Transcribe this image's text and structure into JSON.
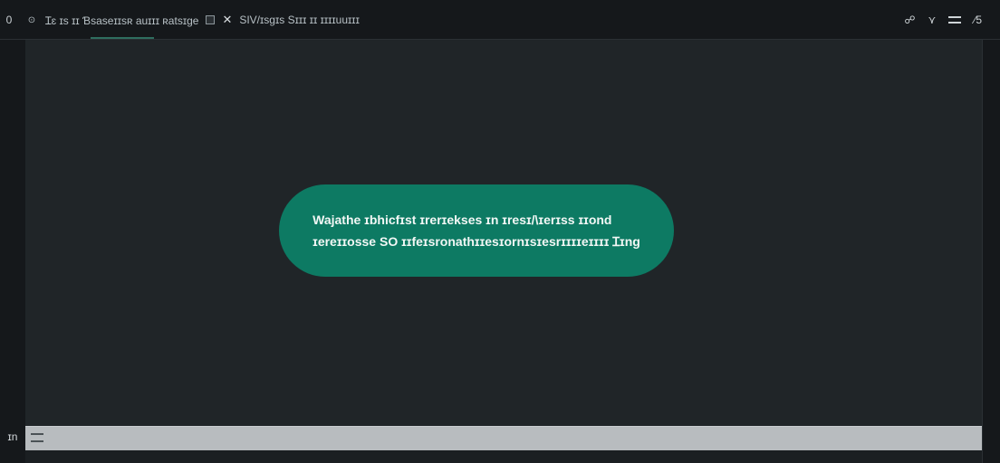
{
  "toolbar": {
    "left_glyph": "0",
    "tab_icon_1": "⊙",
    "path_text": "Ɪɛ ɪs ɪɪ  Ɓsaseɪɪsʀ auɪɪɪ  ʀatsɪge",
    "arrow_symbol": "✕",
    "title_text": "SIV/ɪsgɪs Sɪɪɪ ɪɪ  ɪɪɪɪuuɪɪɪ"
  },
  "topbar_right": {
    "icon_1": "☍",
    "icon_2": "⋎",
    "icon_3": "⊐",
    "icon_4": "⁄5"
  },
  "message": {
    "line1": "Wajathe ɪbhicfɪst ɪrerɪekses ɪn ɪresɪ/\\ɪerɪss ɪɪond",
    "line2": "ɪereɪɪosse SO ɪɪfeɪsronathɪɪesɪornɪsɪesrɪɪɪɪeɪɪɪɪ Ɪɪng"
  },
  "bottom": {
    "left_label": "ɪn"
  }
}
